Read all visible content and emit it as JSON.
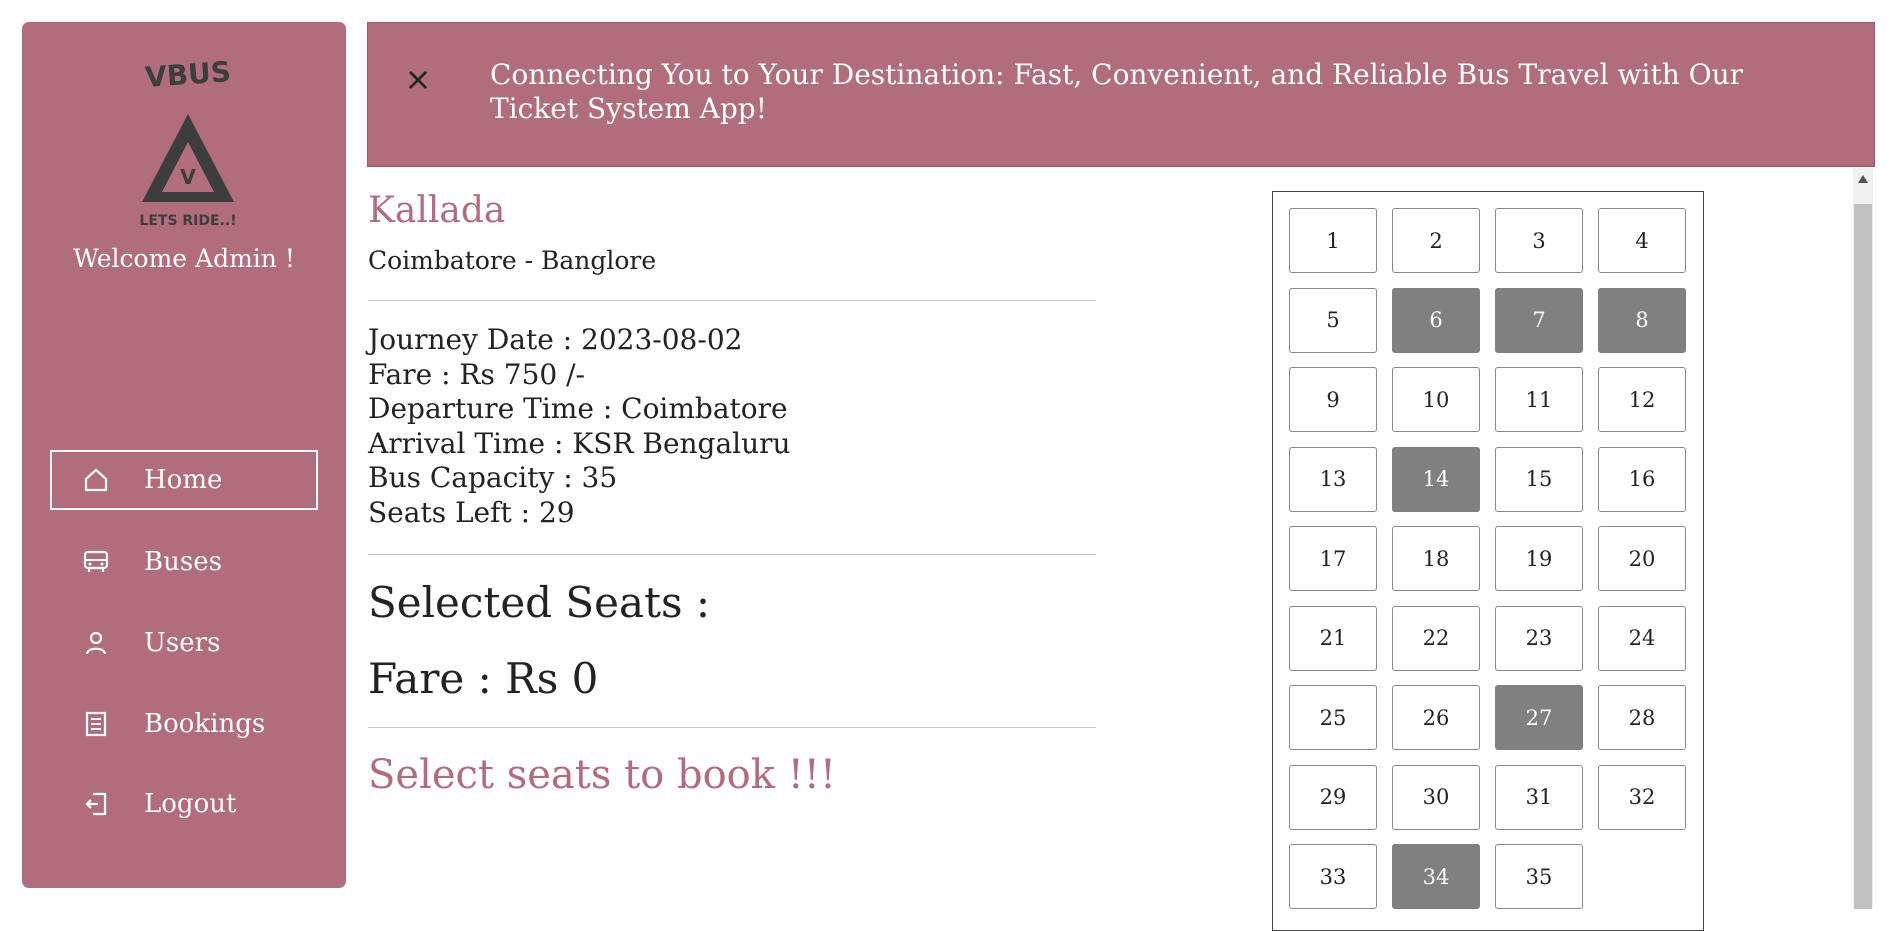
{
  "sidebar": {
    "logo": {
      "top_text": "VBUS",
      "letter": "V",
      "tagline": "LETS RIDE..!"
    },
    "welcome": "Welcome Admin !",
    "items": [
      {
        "label": "Home",
        "icon": "home-icon",
        "active": true
      },
      {
        "label": "Buses",
        "icon": "bus-icon",
        "active": false
      },
      {
        "label": "Users",
        "icon": "user-icon",
        "active": false
      },
      {
        "label": "Bookings",
        "icon": "bookings-icon",
        "active": false
      },
      {
        "label": "Logout",
        "icon": "logout-icon",
        "active": false
      }
    ]
  },
  "banner": {
    "close": "×",
    "text": "Connecting You to Your Destination: Fast, Convenient, and Reliable Bus Travel with Our Ticket System App!"
  },
  "bus": {
    "name": "Kallada",
    "route": "Coimbatore - Banglore",
    "details": [
      "Journey Date : 2023-08-02",
      "Fare : Rs 750 /-",
      "Departure Time : Coimbatore",
      "Arrival Time : KSR Bengaluru",
      "Bus Capacity : 35",
      "Seats Left : 29"
    ]
  },
  "selection": {
    "selected_label": "Selected Seats :",
    "fare_label": "Fare : Rs 0",
    "cta": "Select seats to book !!!"
  },
  "seats": {
    "total": 35,
    "booked": [
      6,
      7,
      8,
      14,
      27,
      34
    ],
    "labels": [
      "1",
      "2",
      "3",
      "4",
      "5",
      "6",
      "7",
      "8",
      "9",
      "10",
      "11",
      "12",
      "13",
      "14",
      "15",
      "16",
      "17",
      "18",
      "19",
      "20",
      "21",
      "22",
      "23",
      "24",
      "25",
      "26",
      "27",
      "28",
      "29",
      "30",
      "31",
      "32",
      "33",
      "34",
      "35"
    ]
  },
  "colors": {
    "brand": "#b26d7d",
    "booked_seat": "#808080",
    "available_seat": "#ffffff"
  }
}
